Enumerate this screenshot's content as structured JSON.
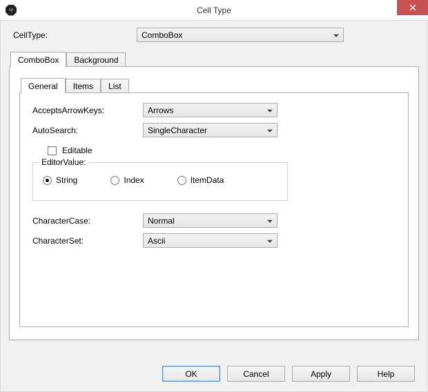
{
  "window": {
    "title": "Cell Type"
  },
  "celltype": {
    "label": "CellType:",
    "value": "ComboBox"
  },
  "outerTabs": {
    "items": [
      {
        "label": "ComboBox",
        "active": true
      },
      {
        "label": "Background",
        "active": false
      }
    ]
  },
  "innerTabs": {
    "items": [
      {
        "label": "General",
        "active": true
      },
      {
        "label": "Items",
        "active": false
      },
      {
        "label": "List",
        "active": false
      }
    ]
  },
  "general": {
    "acceptsArrowKeys": {
      "label": "AcceptsArrowKeys:",
      "value": "Arrows"
    },
    "autoSearch": {
      "label": "AutoSearch:",
      "value": "SingleCharacter"
    },
    "editable": {
      "label": "Editable",
      "checked": false
    },
    "editorValue": {
      "legend": "EditorValue:",
      "options": [
        {
          "label": "String",
          "checked": true
        },
        {
          "label": "Index",
          "checked": false
        },
        {
          "label": "ItemData",
          "checked": false
        }
      ]
    },
    "characterCase": {
      "label": "CharacterCase:",
      "value": "Normal"
    },
    "characterSet": {
      "label": "CharacterSet:",
      "value": "Ascii"
    }
  },
  "buttons": {
    "ok": "OK",
    "cancel": "Cancel",
    "apply": "Apply",
    "help": "Help"
  }
}
